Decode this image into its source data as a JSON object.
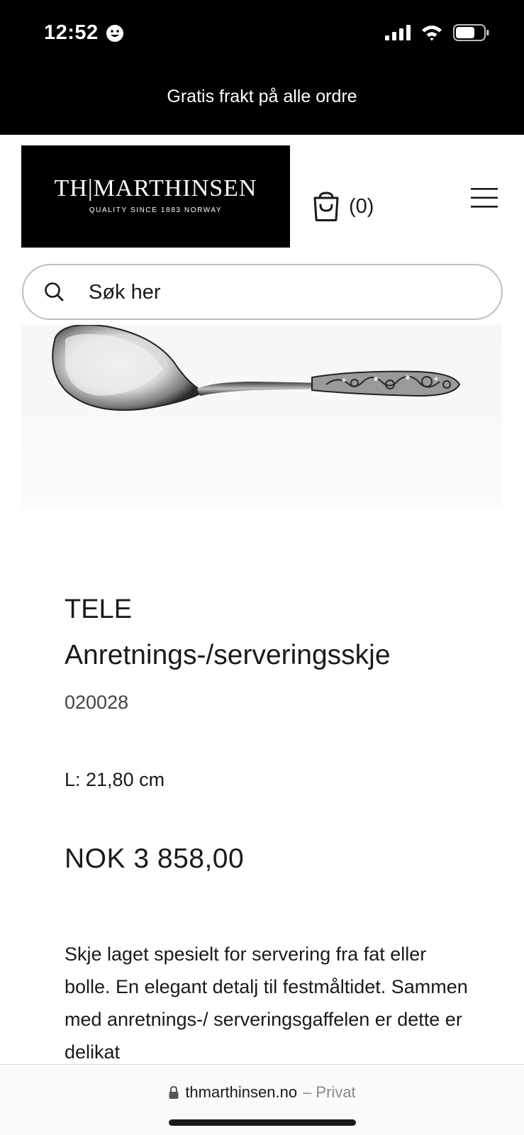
{
  "status_bar": {
    "time": "12:52",
    "emoji_icon": "smiley-face-icon",
    "icons": [
      "cellular-signal-icon",
      "wifi-icon",
      "battery-icon"
    ]
  },
  "promo_banner": {
    "text": "Gratis frakt på alle ordre"
  },
  "header": {
    "logo_main": "TH|MARTHINSEN",
    "logo_sub": "QUALITY SINCE 1883  NORWAY",
    "cart_count": "(0)",
    "cart_icon": "shopping-bag-icon",
    "menu_icon": "hamburger-menu-icon"
  },
  "search": {
    "placeholder": "Søk her",
    "icon": "search-icon"
  },
  "product": {
    "image_alt": "serving-spoon-image",
    "brand": "TELE",
    "name": "Anretnings-/serveringsskje",
    "sku": "020028",
    "dimension": "L: 21,80 cm",
    "price": "NOK 3 858,00",
    "description": "Skje laget spesielt for servering fra fat eller bolle. En elegant detalj til festmåltidet. Sammen med anretnings-/ serveringsgaffelen er dette er delikat"
  },
  "browser": {
    "url": "thmarthinsen.no",
    "privacy": "– Privat",
    "lock_icon": "lock-icon"
  },
  "colors": {
    "banner_bg": "#000000",
    "text": "#1a1a1a",
    "search_border": "#bdbdbd"
  }
}
